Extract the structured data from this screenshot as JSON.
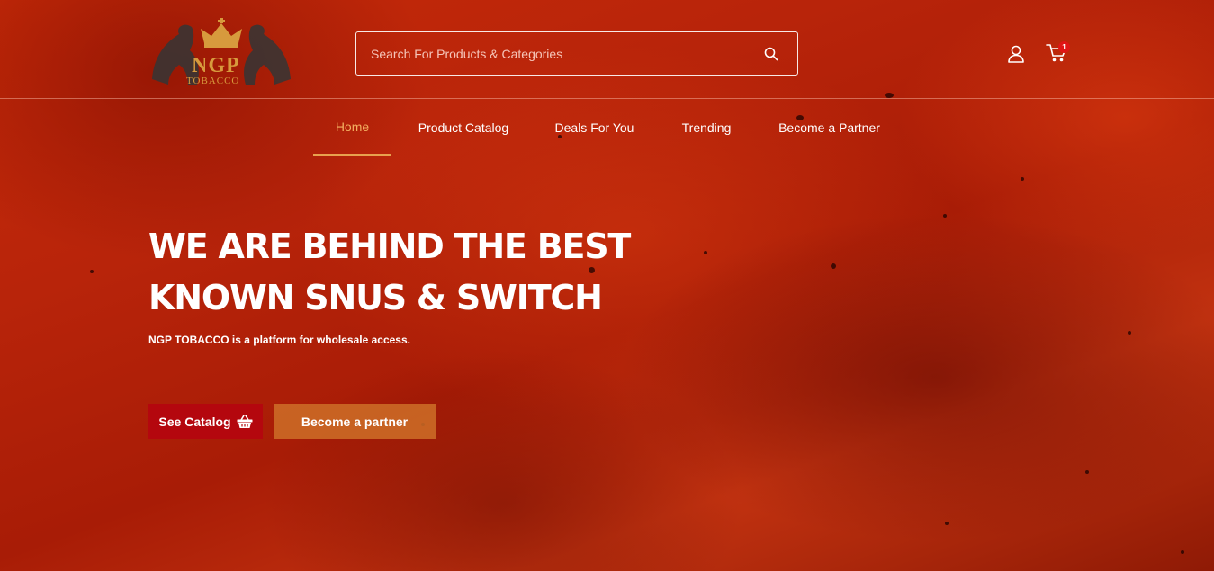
{
  "header": {
    "logo": {
      "name": "NGP",
      "sub": "TOBACCO"
    },
    "search": {
      "placeholder": "Search For Products & Categories"
    },
    "cart": {
      "count": "1"
    }
  },
  "nav": {
    "items": [
      {
        "label": "Home",
        "active": true
      },
      {
        "label": "Product Catalog"
      },
      {
        "label": "Deals For You"
      },
      {
        "label": "Trending"
      },
      {
        "label": "Become a Partner"
      }
    ]
  },
  "hero": {
    "title_line1": "WE ARE BEHIND THE BEST",
    "title_line2": "KNOWN SNUS & SWITCH",
    "subtitle": "NGP TOBACCO is a platform for wholesale access.",
    "catalog_button": "See Catalog",
    "partner_button": "Become a partner"
  },
  "icons": {
    "search": "search-icon",
    "user": "user-icon",
    "cart": "cart-icon",
    "basket": "basket-icon"
  },
  "colors": {
    "accent": "#e8a14e",
    "catalog_button": "#b4070e",
    "partner_button": "#ce6e28",
    "badge": "#e01515"
  }
}
